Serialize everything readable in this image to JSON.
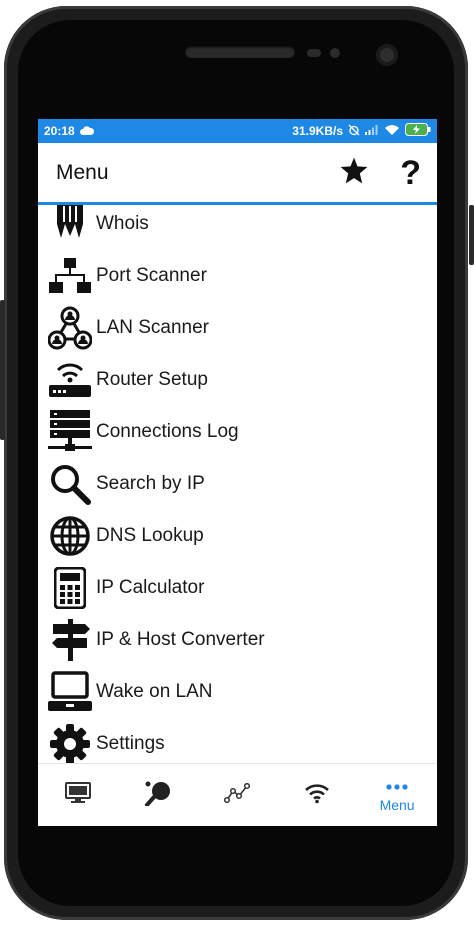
{
  "status": {
    "time": "20:18",
    "speed": "31.9KB/s"
  },
  "appbar": {
    "title": "Menu"
  },
  "menu": {
    "items": [
      {
        "label": "Whois",
        "icon": "whois-icon"
      },
      {
        "label": "Port Scanner",
        "icon": "port-scanner-icon"
      },
      {
        "label": "LAN Scanner",
        "icon": "lan-scanner-icon"
      },
      {
        "label": "Router Setup",
        "icon": "router-icon"
      },
      {
        "label": "Connections Log",
        "icon": "connections-log-icon"
      },
      {
        "label": "Search by IP",
        "icon": "search-icon"
      },
      {
        "label": "DNS Lookup",
        "icon": "globe-icon"
      },
      {
        "label": "IP Calculator",
        "icon": "calculator-icon"
      },
      {
        "label": "IP & Host Converter",
        "icon": "signpost-icon"
      },
      {
        "label": "Wake on LAN",
        "icon": "laptop-icon"
      },
      {
        "label": "Settings",
        "icon": "gear-icon"
      }
    ]
  },
  "nav": {
    "menu_label": "Menu"
  },
  "colors": {
    "accent": "#1e88e5",
    "icon": "#111111"
  }
}
